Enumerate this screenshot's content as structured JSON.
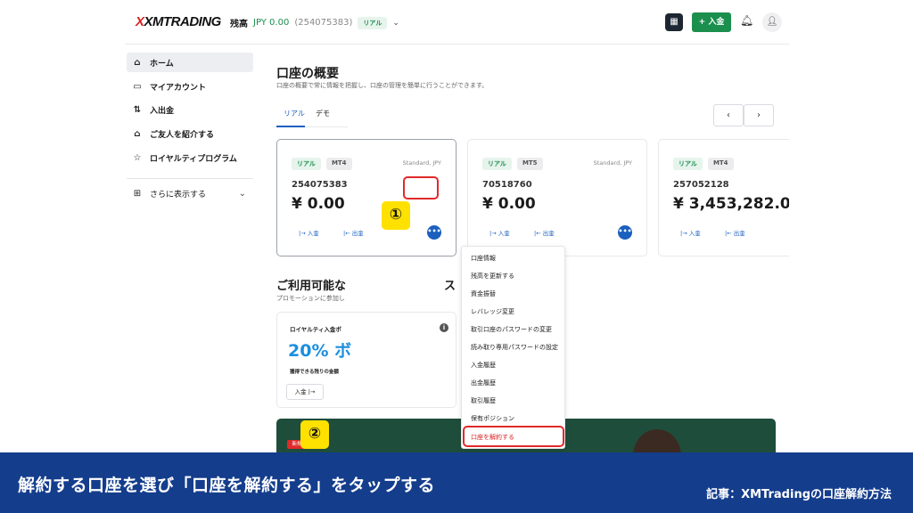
{
  "header": {
    "logo": "XMTRADING",
    "logo_mark": "X",
    "balance_label": "残高",
    "balance_amount": "JPY 0.00",
    "account_number": "(254075383)",
    "account_tag": "リアル",
    "qr_icon": "qr-icon",
    "deposit_button": "+ 入金"
  },
  "sidebar": {
    "items": [
      {
        "label": "ホーム",
        "icon": "⌂"
      },
      {
        "label": "マイアカウント",
        "icon": "▭"
      },
      {
        "label": "入出金",
        "icon": "⇅"
      },
      {
        "label": "ご友人を紹介する",
        "icon": "⌂"
      },
      {
        "label": "ロイヤルティプログラム",
        "icon": "☆"
      }
    ],
    "more_label": "さらに表示する"
  },
  "main": {
    "title": "口座の概要",
    "subtitle": "口座の概要で常に情報を把握し、口座の管理を簡単に行うことができます。",
    "tabs": [
      "リアル",
      "デモ"
    ],
    "prev_arrow": "‹",
    "next_arrow": "›"
  },
  "cards": [
    {
      "tag": "リアル",
      "platform": "MT4",
      "type": "Standard, JPY",
      "account": "254075383",
      "balance": "¥ 0.00",
      "deposit": "入金",
      "withdraw": "出金"
    },
    {
      "tag": "リアル",
      "platform": "MT5",
      "type": "Standard, JPY",
      "account": "70518760",
      "balance": "¥ 0.00",
      "deposit": "入金",
      "withdraw": "出金"
    },
    {
      "tag": "リアル",
      "platform": "MT4",
      "type": "",
      "account": "257052128",
      "balance": "¥ 3,453,282.0",
      "deposit": "入金",
      "withdraw": "出金"
    }
  ],
  "promotions": {
    "title_visible": "ご利用可能な",
    "title_tail": "ス",
    "subtitle": "プロモーションに参加し",
    "card_title": "ロイヤルティ入金ボ",
    "big_text": "20% ボ",
    "desc": "獲得できる残りの金額",
    "deposit_button": "入金 |→",
    "banner_tag": "新規"
  },
  "menu": {
    "items": [
      "口座情報",
      "残高を更新する",
      "資金振替",
      "レバレッジ変更",
      "取引口座のパスワードの変更",
      "読み取り専用パスワードの設定",
      "入金履歴",
      "出金履歴",
      "取引履歴",
      "保有ポジション",
      "口座を解約する"
    ]
  },
  "annotations": {
    "step1": "①",
    "step2": "②"
  },
  "caption": {
    "main": "解約する口座を選び「口座を解約する」をタップする",
    "side": "記事：XMTradingの口座解約方法"
  }
}
